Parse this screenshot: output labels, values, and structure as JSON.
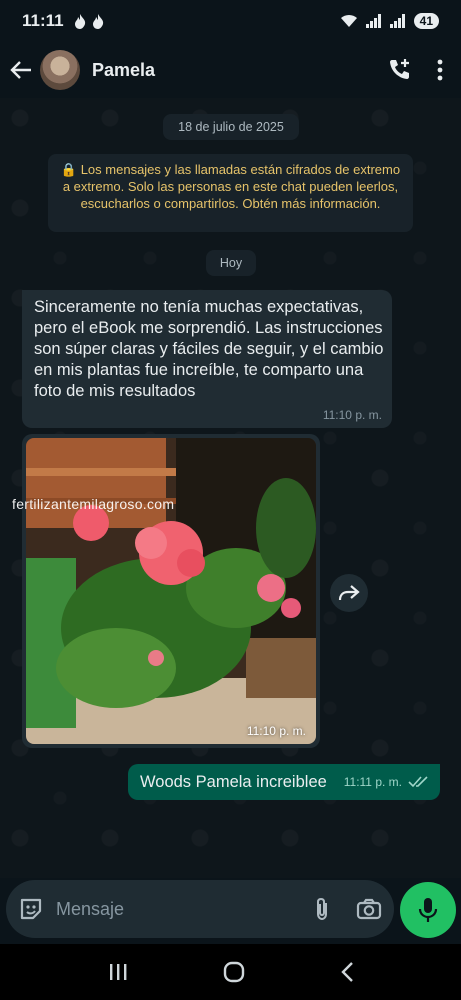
{
  "status_bar": {
    "time": "11:11",
    "battery": "41"
  },
  "header": {
    "contact_name": "Pamela"
  },
  "chat": {
    "date_chip": "18 de julio de 2025",
    "encryption_notice": "🔒 Los mensajes y las llamadas están cifrados de extremo a extremo. Solo las personas en este chat pueden leerlos, escucharlos o compartirlos. Obtén más información.",
    "today_chip": "Hoy",
    "messages": [
      {
        "direction": "in",
        "text": "Sinceramente no tenía muchas expectativas, pero el eBook me sorprendió. Las instrucciones son súper claras y fáciles de seguir, y el cambio en mis plantas fue increíble, te comparto una foto de mis resultados",
        "time": "11:10 p. m."
      },
      {
        "direction": "in",
        "type": "image",
        "watermark": "fertilizantemilagroso.com",
        "time": "11:10 p. m."
      },
      {
        "direction": "out",
        "text": "Woods Pamela increiblee",
        "time": "11:11 p. m.",
        "status": "read"
      }
    ]
  },
  "composer": {
    "placeholder": "Mensaje"
  },
  "colors": {
    "accent": "#21c063",
    "outgoing_bubble": "#005c4b",
    "incoming_bubble": "#202c33",
    "background": "#0b141a"
  },
  "icons": [
    "flame-icon",
    "wifi-icon",
    "signal-icon",
    "back-arrow-icon",
    "add-call-icon",
    "more-vert-icon",
    "forward-icon",
    "double-check-icon",
    "sticker-icon",
    "attach-icon",
    "camera-icon",
    "mic-icon",
    "recents-icon",
    "home-icon",
    "nav-back-icon"
  ]
}
